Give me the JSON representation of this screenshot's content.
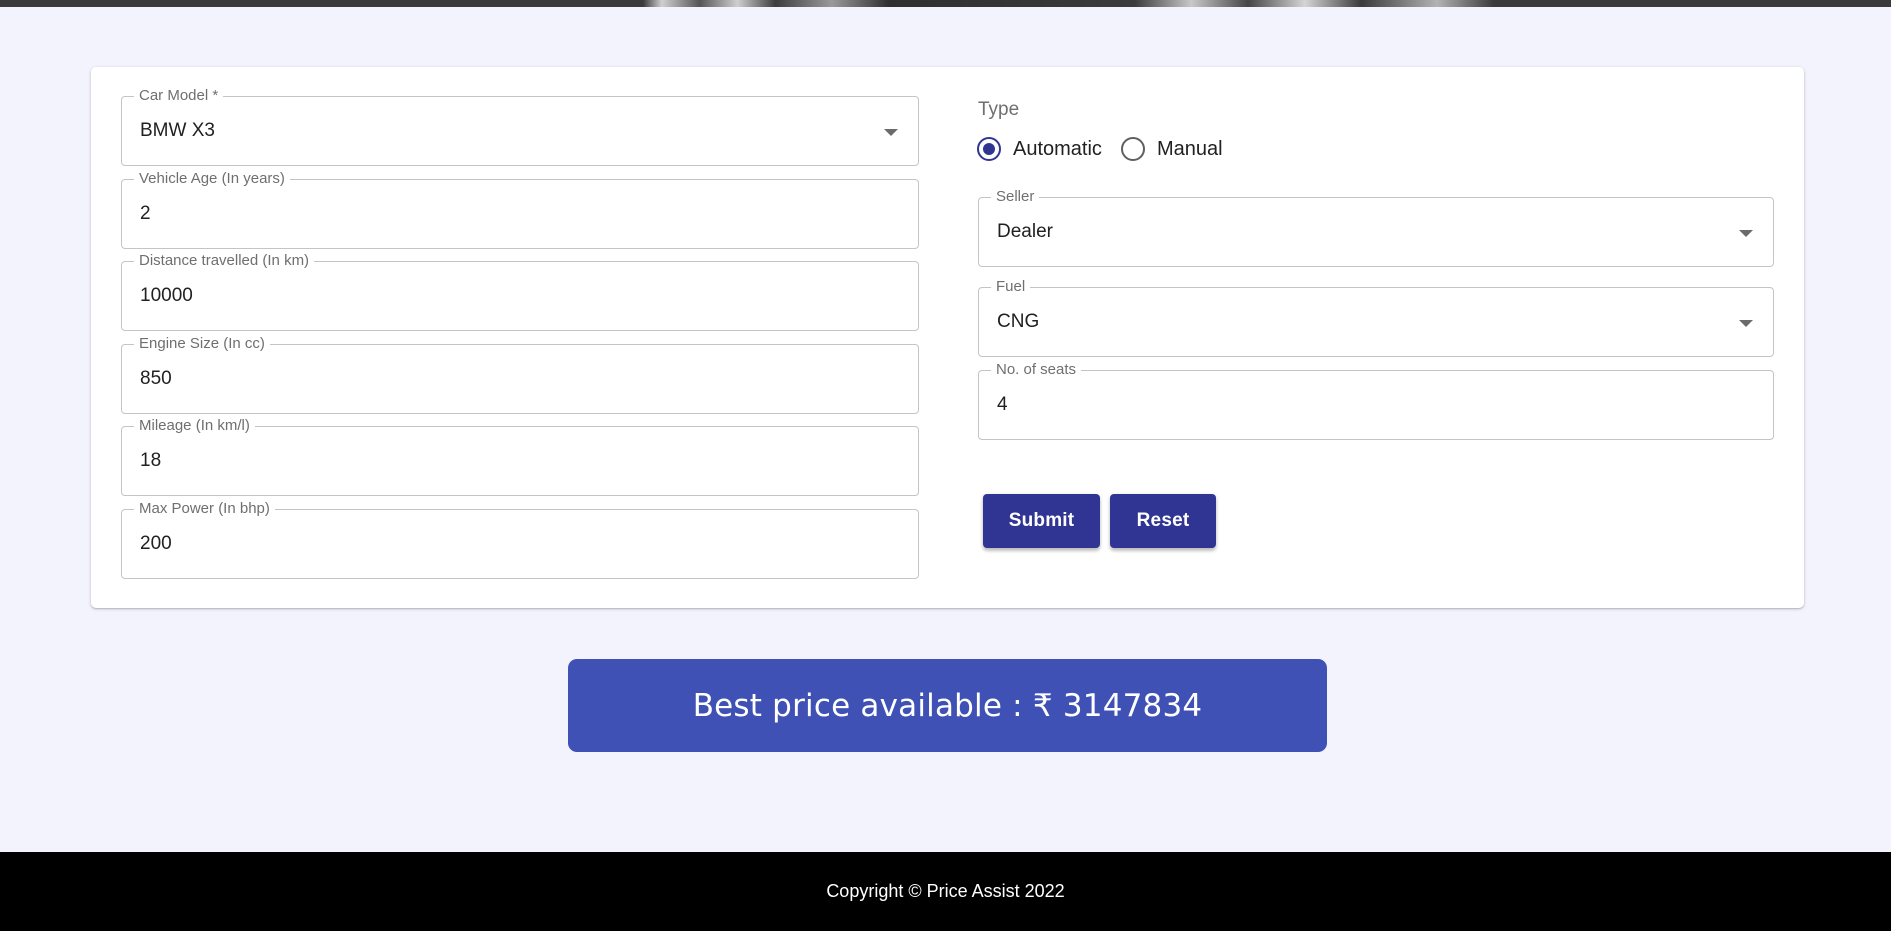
{
  "form": {
    "left_fields": [
      {
        "label": "Car Model *",
        "value": "BMW X3",
        "type": "select"
      },
      {
        "label": "Vehicle Age (In years)",
        "value": "2",
        "type": "input"
      },
      {
        "label": "Distance travelled (In km)",
        "value": "10000",
        "type": "input"
      },
      {
        "label": "Engine Size (In cc)",
        "value": "850",
        "type": "input"
      },
      {
        "label": "Mileage (In km/l)",
        "value": "18",
        "type": "input"
      },
      {
        "label": "Max Power (In bhp)",
        "value": "200",
        "type": "input"
      }
    ],
    "type_label": "Type",
    "type_options": [
      {
        "label": "Automatic",
        "selected": true
      },
      {
        "label": "Manual",
        "selected": false
      }
    ],
    "seller": {
      "label": "Seller",
      "value": "Dealer"
    },
    "fuel": {
      "label": "Fuel",
      "value": "CNG"
    },
    "seats": {
      "label": "No. of seats",
      "value": "4"
    },
    "submit_label": "Submit",
    "reset_label": "Reset"
  },
  "result": {
    "price_text": "Best price available : ₹ 3147834"
  },
  "footer": {
    "copyright": "Copyright © Price Assist 2022"
  },
  "colors": {
    "page_background": "#f3f3fd",
    "button": "#303593",
    "price_banner": "#3f51b5",
    "footer_background": "#000000"
  }
}
